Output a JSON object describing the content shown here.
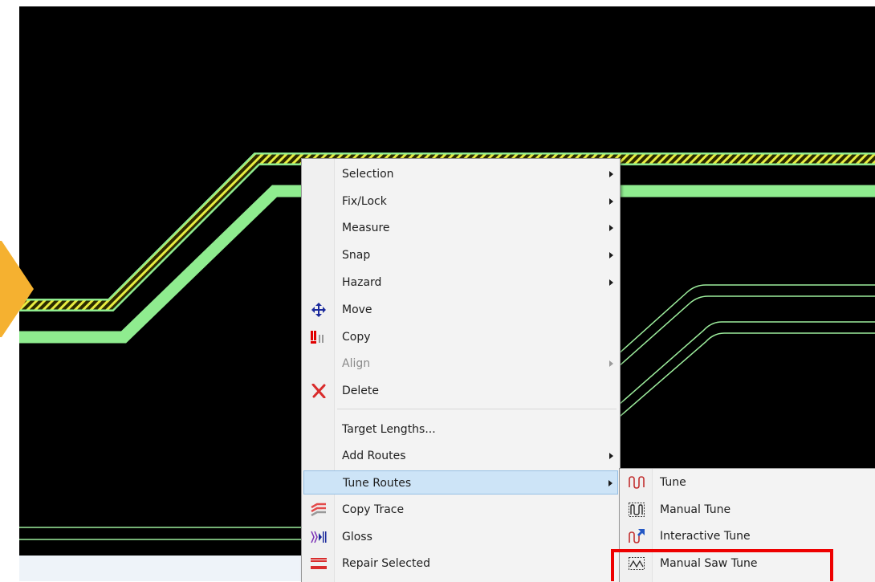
{
  "colors": {
    "canvas_bg": "#000000",
    "trace_green": "#8fec8f",
    "hatch_yellow": "#e8ec40",
    "outline_green": "#9dee9d",
    "annotation_red": "#ee0000",
    "arrow_orange": "#f5b130"
  },
  "context_menu": {
    "items": [
      {
        "label": "Selection",
        "icon": "",
        "submenu": true
      },
      {
        "label": "Fix/Lock",
        "icon": "",
        "submenu": true
      },
      {
        "label": "Measure",
        "icon": "",
        "submenu": true
      },
      {
        "label": "Snap",
        "icon": "",
        "submenu": true
      },
      {
        "label": "Hazard",
        "icon": "",
        "submenu": true
      },
      {
        "label": "Move",
        "icon": "move-icon",
        "submenu": false
      },
      {
        "label": "Copy",
        "icon": "copy-icon",
        "submenu": false
      },
      {
        "label": "Align",
        "icon": "",
        "submenu": true,
        "disabled": true
      },
      {
        "label": "Delete",
        "icon": "delete-icon",
        "submenu": false
      },
      {
        "label": "Target Lengths...",
        "icon": "",
        "submenu": false
      },
      {
        "label": "Add Routes",
        "icon": "",
        "submenu": true
      },
      {
        "label": "Tune Routes",
        "icon": "",
        "submenu": true,
        "highlighted": true
      },
      {
        "label": "Copy Trace",
        "icon": "copy-trace-icon",
        "submenu": false
      },
      {
        "label": "Gloss",
        "icon": "gloss-icon",
        "submenu": false
      },
      {
        "label": "Repair Selected",
        "icon": "repair-icon",
        "submenu": false
      }
    ]
  },
  "tune_submenu": {
    "items": [
      {
        "label": "Tune",
        "icon": "tune-icon"
      },
      {
        "label": "Manual Tune",
        "icon": "manual-tune-icon"
      },
      {
        "label": "Interactive Tune",
        "icon": "interactive-tune-icon"
      },
      {
        "label": "Manual Saw Tune",
        "icon": "manual-saw-tune-icon",
        "annotated": true
      }
    ]
  }
}
